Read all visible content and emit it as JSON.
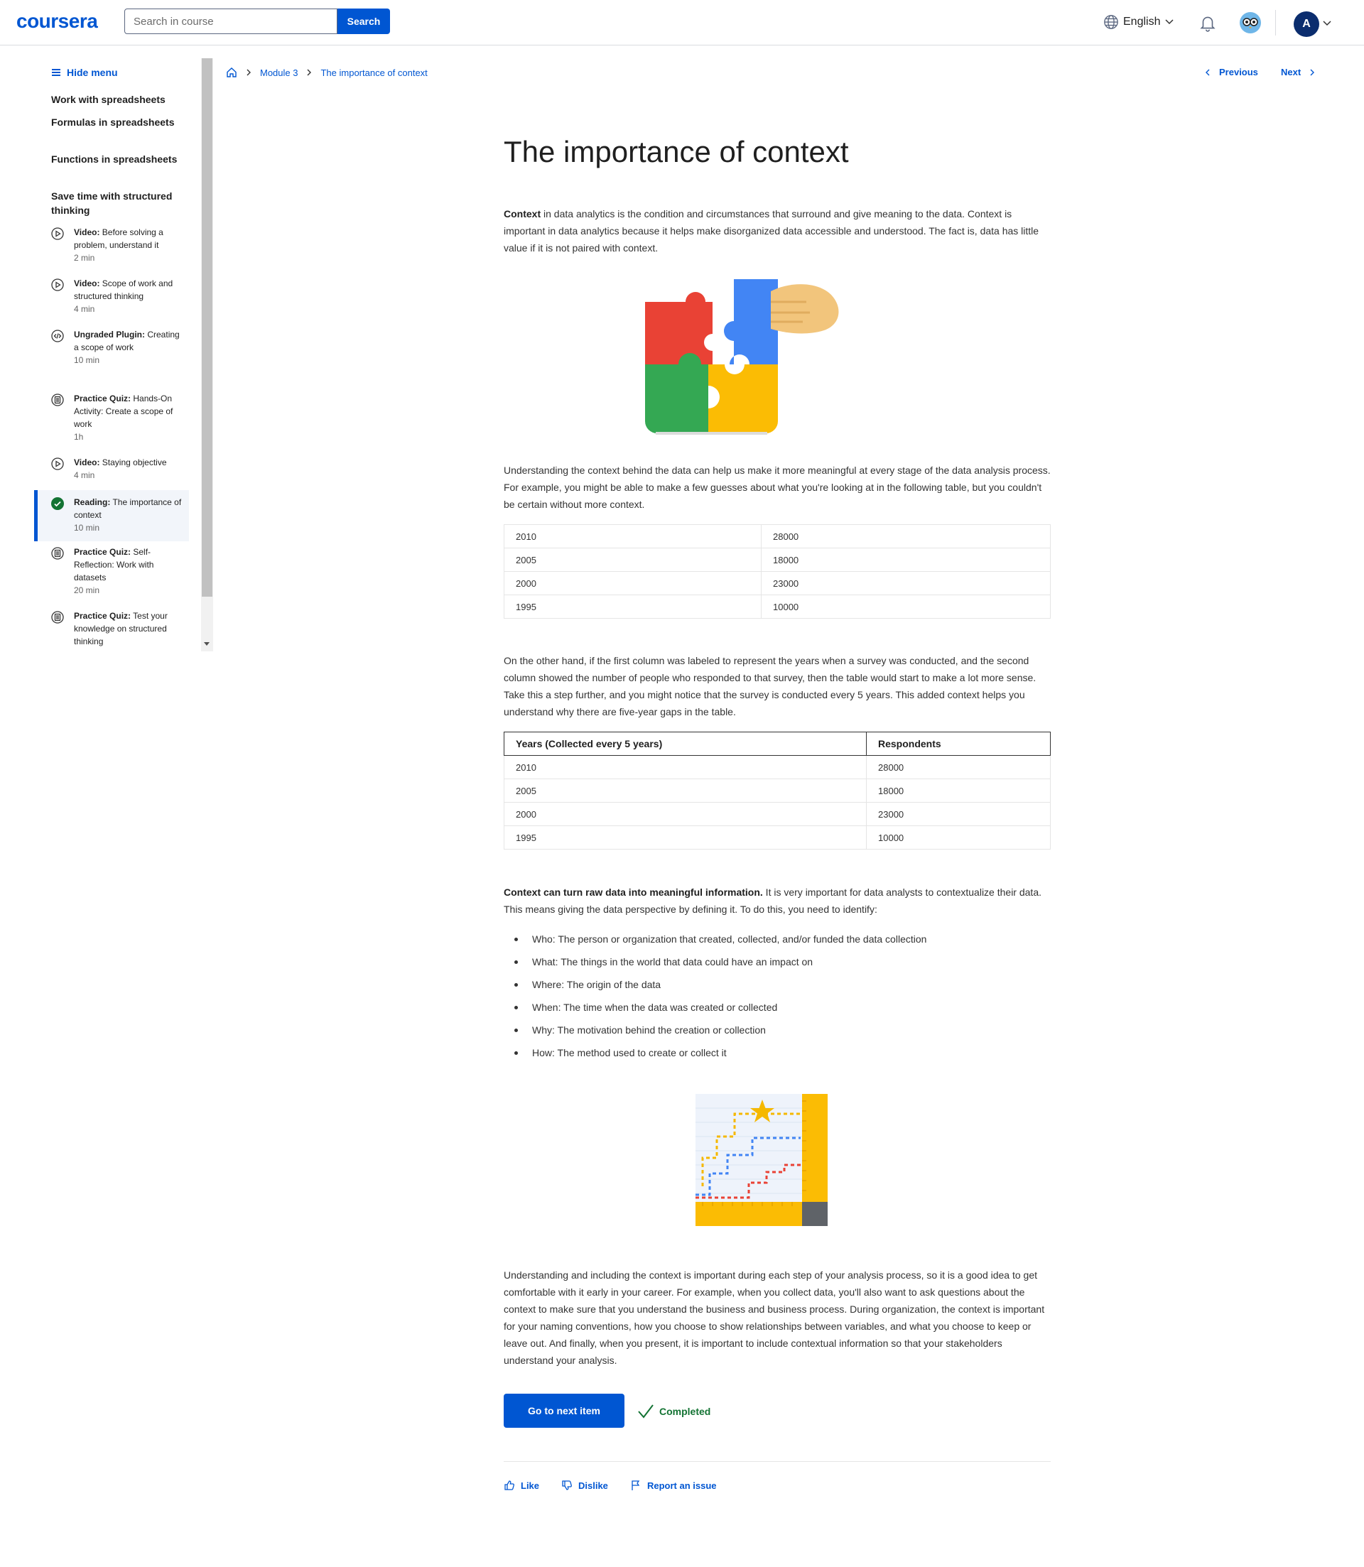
{
  "header": {
    "logo": "coursera",
    "search_placeholder": "Search in course",
    "search_button": "Search",
    "language": "English",
    "avatar_initial": "A"
  },
  "sidebar": {
    "hide_menu": "Hide menu",
    "lessons": [
      "Work with spreadsheets",
      "Formulas in spreadsheets",
      "Functions in spreadsheets",
      "Save time with structured thinking"
    ],
    "items": [
      {
        "type": "Video:",
        "title": "Before solving a problem, understand it",
        "meta": "2 min",
        "icon": "play-icon"
      },
      {
        "type": "Video:",
        "title": "Scope of work and structured thinking",
        "meta": "4 min",
        "icon": "play-icon"
      },
      {
        "type": "Ungraded Plugin:",
        "title": "Creating a scope of work",
        "meta": "10 min",
        "icon": "code-icon"
      },
      {
        "type": "Practice Quiz:",
        "title": "Hands-On Activity: Create a scope of work",
        "meta": "1h",
        "icon": "quiz-icon"
      },
      {
        "type": "Video:",
        "title": "Staying objective",
        "meta": "4 min",
        "icon": "play-icon"
      },
      {
        "type": "Reading:",
        "title": "The importance of context",
        "meta": "10 min",
        "icon": "check-circle-icon"
      },
      {
        "type": "Practice Quiz:",
        "title": "Self-Reflection: Work with datasets",
        "meta": "20 min",
        "icon": "quiz-icon"
      },
      {
        "type": "Practice Quiz:",
        "title": "Test your knowledge on structured thinking",
        "meta": "",
        "icon": "quiz-icon"
      }
    ]
  },
  "breadcrumb": {
    "module": "Module 3",
    "current": "The importance of context"
  },
  "nav": {
    "previous": "Previous",
    "next": "Next"
  },
  "article": {
    "title": "The importance of context",
    "intro_bold": "Context",
    "intro_rest": " in data analytics is the condition and circumstances that surround and give meaning to the data. Context is important in data analytics because it helps make disorganized data accessible and understood. The fact is, data has little value if it is not paired with context.",
    "para2": "Understanding the context behind the data can help us make it more meaningful at every stage of the data analysis process. For example, you might be able to make a few guesses about what you're looking at in the following table, but you couldn't be certain without more context.",
    "table1": [
      [
        "2010",
        "28000"
      ],
      [
        "2005",
        "18000"
      ],
      [
        "2000",
        "23000"
      ],
      [
        "1995",
        "10000"
      ]
    ],
    "para3": "On the other hand, if the first column was labeled to represent the years when a survey was conducted, and the second column showed the number of people who responded to that survey, then the table would start to make a lot more sense. Take this a step further, and you might notice that the survey is conducted every 5 years. This added context helps you understand why there are five-year gaps in the table.",
    "table2_headers": [
      "Years (Collected every 5 years)",
      "Respondents"
    ],
    "table2": [
      [
        "2010",
        "28000"
      ],
      [
        "2005",
        "18000"
      ],
      [
        "2000",
        "23000"
      ],
      [
        "1995",
        "10000"
      ]
    ],
    "para4_bold": "Context can turn raw data into meaningful information.",
    "para4_rest": " It is very important for data analysts to contextualize their data. This means giving the data perspective by defining it. To do this, you need to identify:",
    "bullets": [
      "Who: The person or organization that created, collected, and/or funded the data collection",
      "What: The things in the world that data could have an impact on",
      "Where: The origin of the data",
      "When: The time when the data was created or collected",
      "Why: The motivation behind the creation or collection",
      "How: The method used to create or collect it"
    ],
    "para5": "Understanding and including the context is important during each step of your analysis process, so it is a good idea to get comfortable with it early in your career. For example, when you collect data, you'll also want to ask questions about the context to make sure that you understand the business and business process. During organization, the context is important for your naming conventions, how you choose to show relationships between variables, and what you choose to keep or leave out. And finally, when you present, it is important to include contextual information so that your stakeholders understand your analysis.",
    "next_button": "Go to next item",
    "completed": "Completed"
  },
  "feedback": {
    "like": "Like",
    "dislike": "Dislike",
    "report": "Report an issue"
  },
  "colors": {
    "brand": "#0056d2",
    "success": "#137333"
  }
}
